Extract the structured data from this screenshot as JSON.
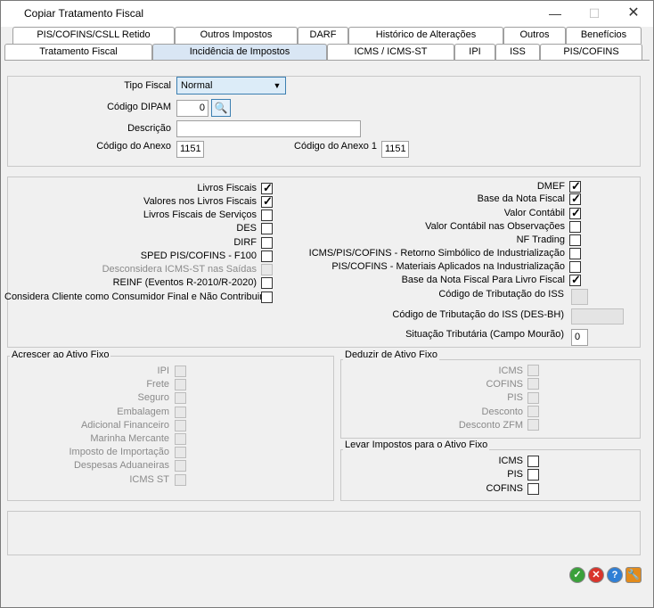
{
  "window": {
    "title": "Copiar Tratamento Fiscal"
  },
  "tabs_row1": [
    "PIS/COFINS/CSLL Retido",
    "Outros Impostos",
    "DARF",
    "Histórico de Alterações",
    "Outros",
    "Benefícios"
  ],
  "tabs_row2": [
    "Tratamento Fiscal",
    "Incidência de Impostos",
    "ICMS / ICMS-ST",
    "IPI",
    "ISS",
    "PIS/COFINS"
  ],
  "form": {
    "tipo_fiscal_label": "Tipo Fiscal",
    "tipo_fiscal_value": "Normal",
    "codigo_dipam_label": "Código DIPAM",
    "codigo_dipam_value": "0",
    "descricao_label": "Descrição",
    "descricao_value": "",
    "codigo_anexo_label": "Código do Anexo",
    "codigo_anexo_value": "1151",
    "codigo_anexo1_label": "Código do Anexo 1",
    "codigo_anexo1_value": "1151"
  },
  "left_checks": [
    {
      "label": "Livros Fiscais",
      "checked": true,
      "disabled": false
    },
    {
      "label": "Valores nos Livros Fiscais",
      "checked": true,
      "disabled": false
    },
    {
      "label": "Livros Fiscais de Serviços",
      "checked": false,
      "disabled": false
    },
    {
      "label": "DES",
      "checked": false,
      "disabled": false
    },
    {
      "label": "DIRF",
      "checked": false,
      "disabled": false
    },
    {
      "label": "SPED PIS/COFINS - F100",
      "checked": false,
      "disabled": false
    },
    {
      "label": "Desconsidera ICMS-ST nas Saídas",
      "checked": false,
      "disabled": true
    },
    {
      "label": "REINF (Eventos R-2010/R-2020)",
      "checked": false,
      "disabled": false
    },
    {
      "label": "Considera Cliente como Consumidor Final e Não Contribuinte",
      "checked": false,
      "disabled": false
    }
  ],
  "right_checks": [
    {
      "label": "DMEF",
      "checked": true,
      "disabled": false
    },
    {
      "label": "Base da Nota Fiscal",
      "checked": true,
      "disabled": false
    },
    {
      "label": "Valor Contábil",
      "checked": true,
      "disabled": false
    },
    {
      "label": "Valor Contábil nas Observações",
      "checked": false,
      "disabled": false
    },
    {
      "label": "NF Trading",
      "checked": false,
      "disabled": false
    },
    {
      "label": "ICMS/PIS/COFINS - Retorno Simbólico de Industrialização",
      "checked": false,
      "disabled": false
    },
    {
      "label": "PIS/COFINS - Materiais Aplicados na Industrialização",
      "checked": false,
      "disabled": false
    },
    {
      "label": "Base da Nota Fiscal Para Livro Fiscal",
      "checked": true,
      "disabled": false
    }
  ],
  "iss": {
    "cod_trib_iss_label": "Código de Tributação do ISS",
    "cod_trib_iss_desbh_label": "Código de Tributação do ISS (DES-BH)",
    "sit_trib_label": "Situação Tributária (Campo Mourão)",
    "sit_trib_value": "0"
  },
  "acrescer": {
    "title": "Acrescer ao Ativo Fixo",
    "items": [
      "IPI",
      "Frete",
      "Seguro",
      "Embalagem",
      "Adicional Financeiro",
      "Marinha Mercante",
      "Imposto de Importação",
      "Despesas Aduaneiras",
      "ICMS ST"
    ]
  },
  "deduzir": {
    "title": "Deduzir de Ativo Fixo",
    "items": [
      "ICMS",
      "COFINS",
      "PIS",
      "Desconto",
      "Desconto ZFM"
    ]
  },
  "levar": {
    "title": "Levar Impostos para o Ativo Fixo",
    "items": [
      "ICMS",
      "PIS",
      "COFINS"
    ]
  },
  "actions": {
    "ok_icon": "check-icon",
    "cancel_icon": "close-icon",
    "help_icon": "help-icon",
    "tools_icon": "wrench-icon"
  },
  "colors": {
    "ok": "#3aa13a",
    "cancel": "#d9342b",
    "help": "#2f7fd6",
    "tools": "#e28b1c"
  }
}
